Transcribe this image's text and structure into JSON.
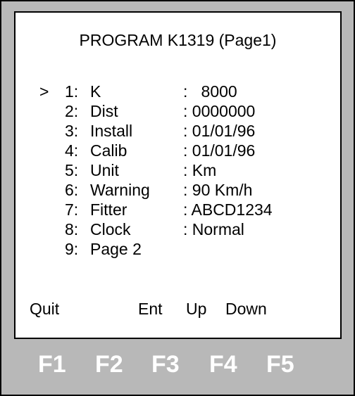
{
  "screen": {
    "title": "PROGRAM K1319  (Page1)",
    "cursor": ">",
    "items": [
      {
        "num": "1:",
        "label": "K",
        "value": ":   8000"
      },
      {
        "num": "2:",
        "label": "Dist",
        "value": ": 0000000"
      },
      {
        "num": "3:",
        "label": "Install",
        "value": ": 01/01/96"
      },
      {
        "num": "4:",
        "label": "Calib",
        "value": ": 01/01/96"
      },
      {
        "num": "5:",
        "label": "Unit",
        "value": ": Km"
      },
      {
        "num": "6:",
        "label": "Warning",
        "value": ": 90 Km/h"
      },
      {
        "num": "7:",
        "label": "Fitter",
        "value": ": ABCD1234"
      },
      {
        "num": "8:",
        "label": "Clock",
        "value": ": Normal"
      },
      {
        "num": "9:",
        "label": "Page 2",
        "value": ""
      }
    ],
    "softkeys": {
      "quit": "Quit",
      "ent": "Ent",
      "up": "Up",
      "down": "Down"
    }
  },
  "function_keys": [
    "F1",
    "F2",
    "F3",
    "F4",
    "F5"
  ],
  "colors": {
    "device_bg": "#b8b8b8",
    "screen_bg": "#ffffff",
    "text": "#000000",
    "fkey_text": "#ffffff"
  }
}
